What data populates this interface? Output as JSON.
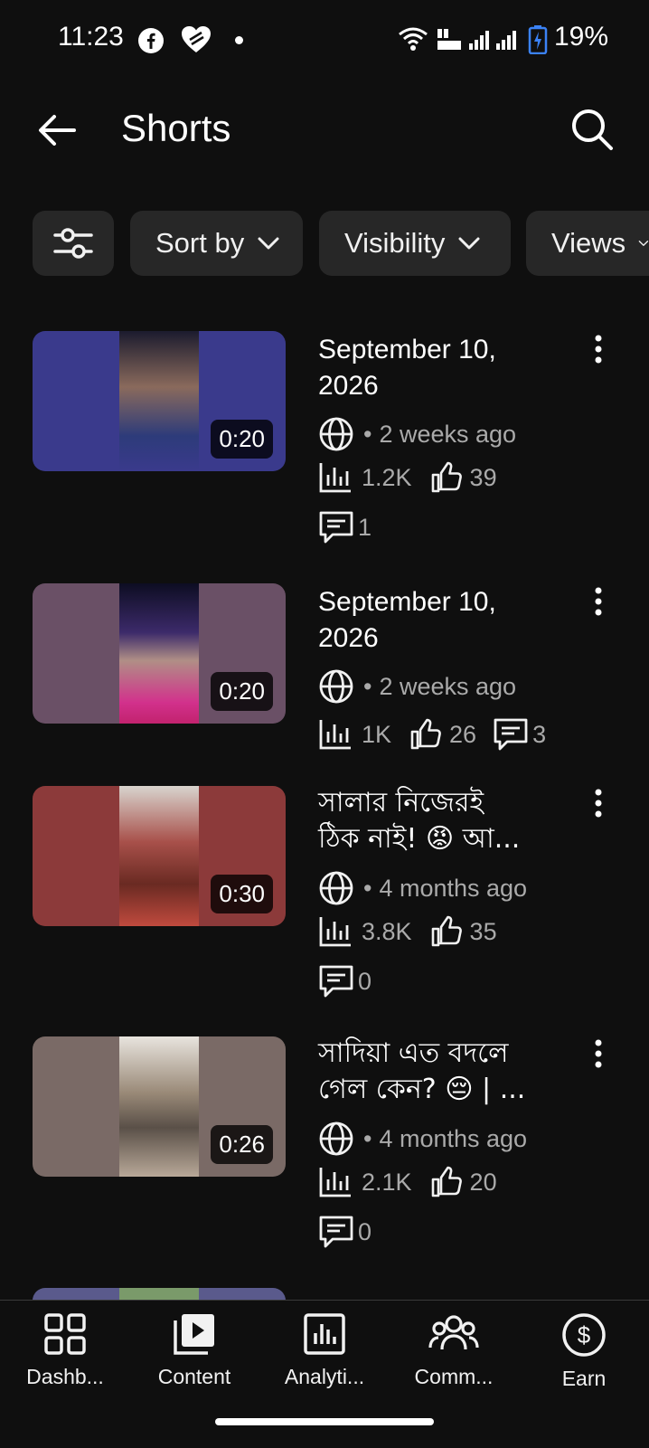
{
  "status_bar": {
    "time": "11:23",
    "battery": "19%"
  },
  "header": {
    "title": "Shorts",
    "back_icon": "arrow-left-icon",
    "search_icon": "search-icon"
  },
  "filters": {
    "filter_icon": "sliders-icon",
    "chips": [
      {
        "label": "Sort by"
      },
      {
        "label": "Visibility"
      },
      {
        "label": "Views"
      }
    ]
  },
  "videos": [
    {
      "title_line1": "September 10,",
      "title_line2": "2026",
      "duration": "0:20",
      "age": "2 weeks ago",
      "views": "1.2K",
      "likes": "39",
      "comments": "1",
      "thumb_color": "#3a3a8c"
    },
    {
      "title_line1": "September 10,",
      "title_line2": "2026",
      "duration": "0:20",
      "age": "2 weeks ago",
      "views": "1K",
      "likes": "26",
      "comments": "3",
      "thumb_color": "#6a5066"
    },
    {
      "title_line1": "সালার নিজেরই",
      "title_line2": "ঠিক নাই! 😡 আ...",
      "duration": "0:30",
      "age": "4 months ago",
      "views": "3.8K",
      "likes": "35",
      "comments": "0",
      "thumb_color": "#8c3a3a"
    },
    {
      "title_line1": "সাদিয়া এত বদলে",
      "title_line2": "গেল কেন? 😔 | ...",
      "duration": "0:26",
      "age": "4 months ago",
      "views": "2.1K",
      "likes": "20",
      "comments": "0",
      "thumb_color": "#7a6a66"
    }
  ],
  "bottom_nav": [
    {
      "label": "Dashb...",
      "icon": "dashboard-icon"
    },
    {
      "label": "Content",
      "icon": "content-icon"
    },
    {
      "label": "Analyti...",
      "icon": "analytics-icon"
    },
    {
      "label": "Comm...",
      "icon": "community-icon"
    },
    {
      "label": "Earn",
      "icon": "earn-icon"
    }
  ]
}
